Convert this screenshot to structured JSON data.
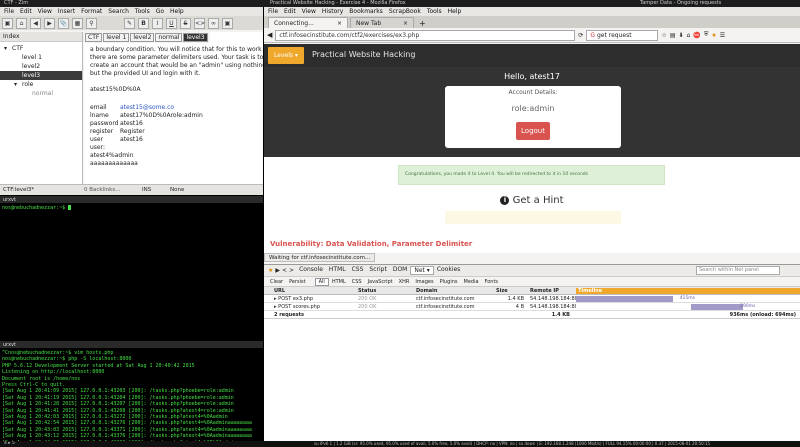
{
  "top_bar": {
    "left_title": "Practical Website Hacking - Exercise 4 - Mozilla Firefox",
    "right_title": "Tamper Data - Ongoing requests",
    "zim_title": "CTF - Zim"
  },
  "zim": {
    "menu": [
      "File",
      "Edit",
      "View",
      "Insert",
      "Format",
      "Search",
      "Tools",
      "Go",
      "Help"
    ],
    "tree_header": "Index",
    "tree": [
      {
        "label": "CTF",
        "indent": 0,
        "expander": "▾"
      },
      {
        "label": "level 1",
        "indent": 1,
        "expander": ""
      },
      {
        "label": "level2",
        "indent": 1,
        "expander": ""
      },
      {
        "label": "level3",
        "indent": 1,
        "expander": "",
        "selected": true
      },
      {
        "label": "role",
        "indent": 1,
        "expander": "▾"
      },
      {
        "label": "normal",
        "indent": 2,
        "expander": ""
      }
    ],
    "crumbs": [
      "CTF",
      "level 1",
      "level2",
      "normal",
      "level3"
    ],
    "doc_lines": [
      {
        "text": "a boundary condition. You will notice that for this to work",
        "link": false
      },
      {
        "text": "there are some parameter delimiters used. Your task is to",
        "link": false
      },
      {
        "text": "create an account that would be an \"admin\" using nothing",
        "link": false
      },
      {
        "text": "but the provided UI and login with it.",
        "link": false
      },
      {
        "text": "",
        "link": false
      },
      {
        "text": "atest15%0D%0A",
        "link": false
      },
      {
        "text": "",
        "link": false
      }
    ],
    "fields": [
      {
        "key": "email",
        "value": "atest15@some.co",
        "link": true
      },
      {
        "key": "lname",
        "value": "atest17%0D%0Arole:admin",
        "link": false
      },
      {
        "key": "password",
        "value": "atest16",
        "link": false
      },
      {
        "key": "register",
        "value": "Register",
        "link": false
      },
      {
        "key": "user",
        "value": "atest16",
        "link": false
      },
      {
        "key": "user:",
        "value": "",
        "link": false
      },
      {
        "key": "atest4%admin",
        "value": "",
        "link": false
      },
      {
        "key": "aaaaaaaaaaaaa",
        "value": "",
        "link": false
      }
    ],
    "status": {
      "page": "CTF:level3*",
      "backlinks": "0 Backlinks...",
      "mode": "INS",
      "style": "None"
    }
  },
  "terminal_top": {
    "title": "urxvt",
    "prompt": "nos@nebuchadnezzar:~$"
  },
  "terminal_bottom": {
    "title": "urxvt",
    "lines": [
      "^Cnos@nebuchadnezzar:~$ vim hosts.php",
      "nos@nebuchadnezzar:~$ php -S localhost:8000",
      "PHP 5.6.12 Development Server started at Sat Aug  1 20:40:42 2015",
      "Listening on http://localhost:8000",
      "Document root is /home/nos",
      "Press Ctrl-C to quit.",
      "[Sat Aug  1 20:41:09 2015] 127.0.0.1:43203 [200]: /tasks.php?phoebe=role:admin",
      "[Sat Aug  1 20:41:19 2015] 127.0.0.1:43204 [200]: /tasks.php?phoebe=role:admin",
      "[Sat Aug  1 20:41:28 2015] 127.0.0.1:43207 [200]: /tasks.php?phoebe=role:admin",
      "[Sat Aug  1 20:41:41 2015] 127.0.0.1:43208 [200]: /tasks.php?atest4=role:admin",
      "[Sat Aug  1 20:42:03 2015] 127.0.0.1:43272 [200]: /tasks.php?atest4=%0Aadmin",
      "[Sat Aug  1 20:42:54 2015] 127.0.0.1:43276 [200]: /tasks.php?atest4=%0Aadminaaaaaaaa",
      "[Sat Aug  1 20:43:03 2015] 127.0.0.1:43371 [200]: /tasks.php?atest4=%0Aadminaaaaaaaa",
      "[Sat Aug  1 20:43:12 2015] 127.0.0.1:43376 [200]: /tasks.php?atest4=%0Aadminaaaaaaaa",
      "[Sat Aug  1 20:44:06 2015] 127.0.0.1:43386 [200]: /tasks.php?atest4=%0D%0Aadminaaaaaa",
      "[Sat Aug  1 20:45:07 2015] 127.0.0.1:43406 [200]: /tasks.php?atest4%0D%0Aadminaaaaaaa"
    ]
  },
  "firefox": {
    "menu": [
      "File",
      "Edit",
      "View",
      "History",
      "Bookmarks",
      "ScrapBook",
      "Tools",
      "Help"
    ],
    "tabs": [
      {
        "label": "Connecting...",
        "active": true
      },
      {
        "label": "New Tab",
        "active": false
      }
    ],
    "url": "ctf.infosecinstitute.com/ctf2/exercises/ex3.php",
    "search_placeholder": "get request",
    "site": {
      "levels_button": "Levels ▾",
      "site_title": "Practical Website Hacking",
      "greeting": "Hello, atest17",
      "account_heading": "Account Details:",
      "role": "role:admin",
      "logout": "Logout",
      "success": "Congratulations, you made it to Level 4. You will be redirected to it in 10 seconds",
      "hint": "Get a Hint",
      "footer_marquee": "Vulnerability: Data Validation, Parameter Delimiter"
    },
    "waiting_status": "Waiting for ctf.infosecinstitute.com...",
    "firebug": {
      "toolbar_tabs": [
        "Console",
        "HTML",
        "CSS",
        "Script",
        "DOM",
        "Net ▾",
        "Cookies"
      ],
      "search_placeholder": "Search within Net panel",
      "filter_tabs": [
        "Clear",
        "Persist",
        "All",
        "HTML",
        "CSS",
        "JavaScript",
        "XHR",
        "Images",
        "Plugins",
        "Media",
        "Fonts"
      ],
      "columns": [
        "URL",
        "Status",
        "Domain",
        "Size",
        "Remote IP",
        "Timeline"
      ],
      "rows": [
        {
          "url": "▸ POST ex3.php",
          "status": "200 OK",
          "domain": "ctf.infosecinstitute.com",
          "size": "1.4 KB",
          "ip": "54.148.198.184:80",
          "time": "415ms",
          "bar_start": 0.0,
          "bar_width": 0.62
        },
        {
          "url": "▸ POST scores.php",
          "status": "200 OK",
          "domain": "ctf.infosecinstitute.com",
          "size": "4 B",
          "ip": "54.148.198.184:80",
          "time": "290ms",
          "bar_start": 0.66,
          "bar_width": 0.33
        }
      ],
      "summary_count": "2 requests",
      "summary_size": "1.4 KB",
      "summary_time": "936ms (onload: 694ms)"
    }
  },
  "bottom_status": {
    "left": "4 ▸ 5",
    "right": "su IPv6 1 | 1.2 GiB (sr: 95.0% used, 95.0% used of avail, 5.0% free, 5.0% avail) | DHCP: no | VPN: no | su down | E: 192.168.1.248 (1000 Mbit/s) | FULL 94.15% 00:00:00 | 0.37 | 2015-08-01 20:50:15"
  },
  "colors": {
    "terminal_green": "#45e045",
    "levels_orange": "#f0a82c",
    "logout_red": "#d9534f",
    "success_green": "#dff0d8",
    "selected_tree": "#3b3b3b"
  }
}
